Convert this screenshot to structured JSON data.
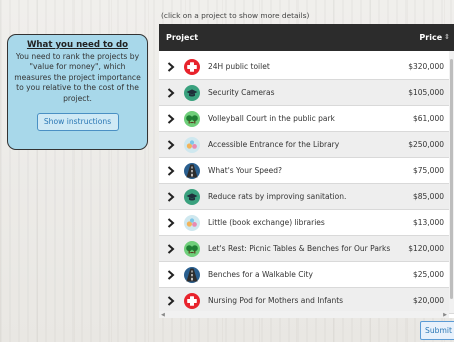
{
  "instructions": {
    "title": "What you need to do",
    "body": "You need to rank the projects by \"value for money\", which measures the project importance to you relative to the cost of the project.",
    "button_label": "Show instructions"
  },
  "hint": "(click on a project to show more details)",
  "table": {
    "col_project": "Project",
    "col_price": "Price",
    "rows": [
      {
        "name": "24H public toilet",
        "price": "$320,000",
        "icon": "health-cross-icon"
      },
      {
        "name": "Security Cameras",
        "price": "$105,000",
        "icon": "graduation-cap-icon"
      },
      {
        "name": "Volleyball Court in the public park",
        "price": "$61,000",
        "icon": "park-icon"
      },
      {
        "name": "Accessible Entrance for the Library",
        "price": "$250,000",
        "icon": "culture-icon"
      },
      {
        "name": "What's Your Speed?",
        "price": "$75,000",
        "icon": "road-icon"
      },
      {
        "name": "Reduce rats by improving sanitation.",
        "price": "$85,000",
        "icon": "graduation-cap-icon"
      },
      {
        "name": "Little (book exchange) libraries",
        "price": "$13,000",
        "icon": "culture-icon"
      },
      {
        "name": "Let's Rest: Picnic Tables & Benches for Our Parks",
        "price": "$120,000",
        "icon": "park-icon"
      },
      {
        "name": "Benches for a Walkable City",
        "price": "$25,000",
        "icon": "road-icon"
      },
      {
        "name": "Nursing Pod for Mothers and Infants",
        "price": "$20,000",
        "icon": "health-cross-icon"
      }
    ]
  },
  "submit_label": "Submit",
  "colors": {
    "panel": "#a8d8ea",
    "header": "#2c2c2c",
    "health": "#e8232c",
    "education": "#3aa17e",
    "park": "#2fae47",
    "road": "#2a5f8f"
  }
}
